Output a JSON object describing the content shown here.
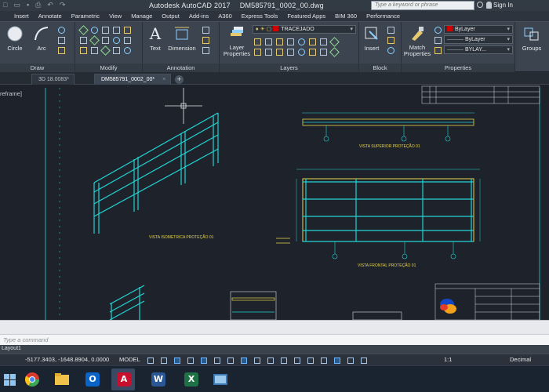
{
  "titlebar": {
    "app_name": "Autodesk AutoCAD 2017",
    "file_name": "DM585791_0002_00.dwg",
    "search_placeholder": "Type a keyword or phrase",
    "sign_in": "Sign In"
  },
  "ribbon_tabs": [
    "Insert",
    "Annotate",
    "Parametric",
    "View",
    "Manage",
    "Output",
    "Add-ins",
    "A360",
    "Express Tools",
    "Featured Apps",
    "BIM 360",
    "Performance"
  ],
  "ribbon": {
    "draw": {
      "title": "Draw",
      "circle": "Circle",
      "arc": "Arc"
    },
    "modify": {
      "title": "Modify"
    },
    "annotation": {
      "title": "Annotation",
      "text": "Text",
      "dimension": "Dimension"
    },
    "layers": {
      "title": "Layers",
      "layer_properties": "Layer Properties",
      "current_layer": "TRACEJADO"
    },
    "block": {
      "title": "Block",
      "insert": "Insert"
    },
    "properties": {
      "title": "Properties",
      "match": "Match Properties",
      "color": "ByLayer",
      "linetype": "ByLayer",
      "lineweight": "BYLAY..."
    },
    "groups": {
      "title": "Groups"
    }
  },
  "file_tabs": [
    {
      "label": "3D 18.0083*"
    },
    {
      "label": "DM585791_0002_00*"
    }
  ],
  "viewport": {
    "label": "reframe]",
    "view_top": "VISTA SUPERIOR PROTEÇÃO 01",
    "view_iso": "VISTA ISOMETRICA PROTEÇÃO 01",
    "view_front": "VISTA FRONTAL PROTEÇÃO 01"
  },
  "command": {
    "prompt": "Type a command"
  },
  "layout": {
    "tab": "Layout1"
  },
  "status": {
    "coords": "-5177.3403, -1648.8904, 0.0000",
    "model": "MODEL",
    "scale": "1:1",
    "units": "Decimal"
  },
  "colors": {
    "drawing_bg": "#1e232b",
    "cyan": "#22d3d3",
    "yellow": "#e8d44a",
    "red_swatch": "#d10000"
  }
}
